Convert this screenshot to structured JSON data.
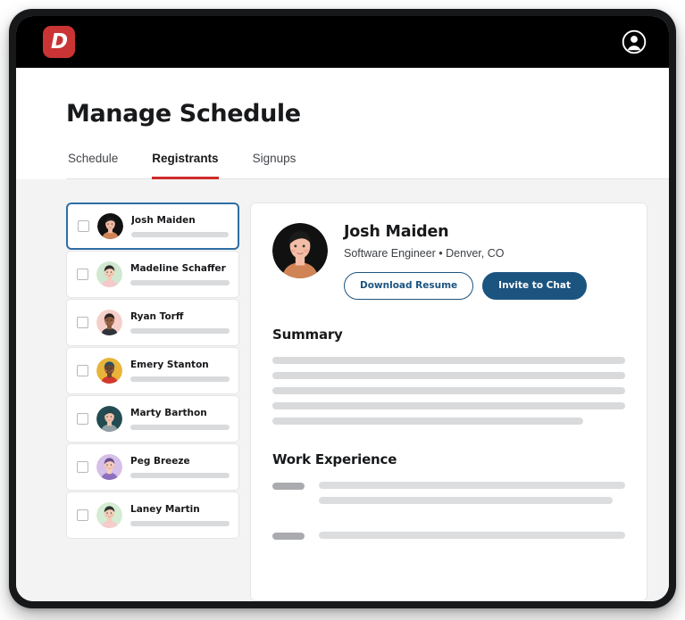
{
  "topbar": {
    "logo_letter": "D",
    "logo_color": "#cb3434",
    "account_icon": "user-circle-icon"
  },
  "header": {
    "title": "Manage Schedule",
    "tabs": [
      {
        "label": "Schedule",
        "active": false
      },
      {
        "label": "Registrants",
        "active": true
      },
      {
        "label": "Signups",
        "active": false
      }
    ],
    "active_tab_underline_color": "#d02a2a"
  },
  "registrants": {
    "selected_index": 0,
    "selected_border_color": "#2f6da4",
    "items": [
      {
        "name": "Josh Maiden",
        "checked": false,
        "avatar": {
          "bg": "#111111",
          "skin": "#f0b9a2",
          "hair": "#1b1b1b",
          "shirt": "#d08354"
        }
      },
      {
        "name": "Madeline Schaffer",
        "checked": false,
        "avatar": {
          "bg": "#cfe8cf",
          "skin": "#f3cdb7",
          "hair": "#2f2b2b",
          "shirt": "#f4c9cb"
        }
      },
      {
        "name": "Ryan Torff",
        "checked": false,
        "avatar": {
          "bg": "#f6cfc8",
          "skin": "#8a5a3e",
          "hair": "#2a2524",
          "shirt": "#2f3338"
        }
      },
      {
        "name": "Emery Stanton",
        "checked": false,
        "avatar": {
          "bg": "#e8b43a",
          "skin": "#6b452f",
          "hair": "#2a4f63",
          "shirt": "#d2382e"
        }
      },
      {
        "name": "Marty Barthon",
        "checked": false,
        "avatar": {
          "bg": "#234c52",
          "skin": "#efc3ad",
          "hair": "#21454a",
          "shirt": "#90a0a4"
        }
      },
      {
        "name": "Peg Breeze",
        "checked": false,
        "avatar": {
          "bg": "#d6bfe8",
          "skin": "#f5cdb8",
          "hair": "#6a4f91",
          "shirt": "#8d6fbe"
        }
      },
      {
        "name": "Laney Martin",
        "checked": false,
        "avatar": {
          "bg": "#d4ecd2",
          "skin": "#f4cdb8",
          "hair": "#2d3330",
          "shirt": "#f6ccce"
        }
      }
    ]
  },
  "detail": {
    "name": "Josh Maiden",
    "meta": "Software Engineer • Denver, CO",
    "avatar": {
      "bg": "#111111",
      "skin": "#f3bda5",
      "hair": "#1b1b1b",
      "shirt": "#d08354"
    },
    "buttons": {
      "download_resume": "Download Resume",
      "invite_to_chat": "Invite to Chat",
      "outline_color": "#1c5480",
      "filled_color": "#1c5480"
    },
    "summary": {
      "title": "Summary",
      "line_widths": [
        "100%",
        "100%",
        "100%",
        "100%",
        "88%"
      ]
    },
    "work_experience": {
      "title": "Work Experience",
      "entries": [
        {
          "line_widths": [
            "100%",
            "96%"
          ]
        },
        {
          "line_widths": [
            "100%"
          ]
        }
      ]
    }
  }
}
